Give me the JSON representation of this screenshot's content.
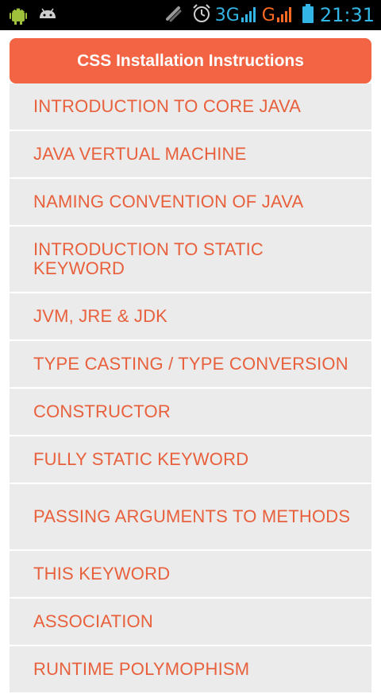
{
  "status_bar": {
    "time": "21:31",
    "network_3g": "3G",
    "network_g": "G",
    "icons": [
      "android-icon",
      "notification-icon",
      "signal-icon",
      "alarm-icon",
      "signal-3g-icon",
      "signal-g-icon",
      "battery-icon"
    ],
    "colors": {
      "accent": "#33b5e5",
      "secondary": "#ff6a22"
    }
  },
  "header": {
    "title": "CSS Installation Instructions",
    "color": "#f26443"
  },
  "list": {
    "item_color": "#e8603c",
    "items": [
      {
        "label": "INTRODUCTION TO CORE JAVA"
      },
      {
        "label": "JAVA VERTUAL MACHINE"
      },
      {
        "label": "NAMING CONVENTION OF JAVA"
      },
      {
        "label": "INTRODUCTION TO STATIC KEYWORD"
      },
      {
        "label": "JVM, JRE & JDK"
      },
      {
        "label": "TYPE CASTING / TYPE CONVERSION"
      },
      {
        "label": "CONSTRUCTOR"
      },
      {
        "label": "FULLY STATIC KEYWORD"
      },
      {
        "label": "PASSING ARGUMENTS TO METHODS"
      },
      {
        "label": "THIS KEYWORD"
      },
      {
        "label": "ASSOCIATION"
      },
      {
        "label": "RUNTIME POLYMOPHISM"
      }
    ]
  }
}
